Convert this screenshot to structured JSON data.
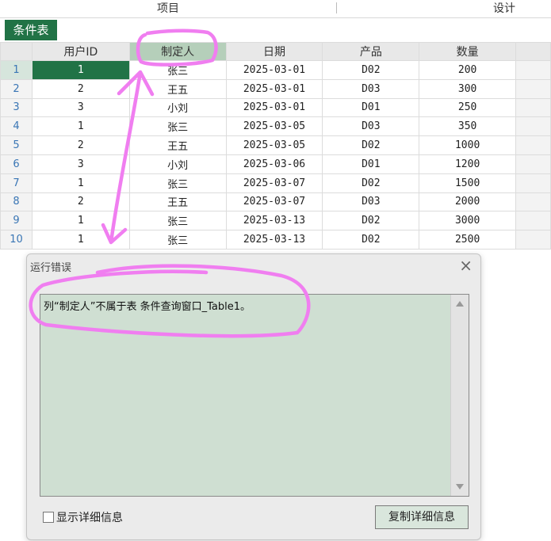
{
  "header": {
    "left_title": "项目",
    "right_title": "设计"
  },
  "tab": {
    "label": "条件表"
  },
  "table": {
    "columns": [
      "用户ID",
      "制定人",
      "日期",
      "产品",
      "数量"
    ],
    "rows": [
      {
        "num": "1",
        "cells": [
          "1",
          "张三",
          "2025-03-01",
          "D02",
          "200"
        ]
      },
      {
        "num": "2",
        "cells": [
          "2",
          "王五",
          "2025-03-01",
          "D03",
          "300"
        ]
      },
      {
        "num": "3",
        "cells": [
          "3",
          "小刘",
          "2025-03-01",
          "D01",
          "250"
        ]
      },
      {
        "num": "4",
        "cells": [
          "1",
          "张三",
          "2025-03-05",
          "D03",
          "350"
        ]
      },
      {
        "num": "5",
        "cells": [
          "2",
          "王五",
          "2025-03-05",
          "D02",
          "1000"
        ]
      },
      {
        "num": "6",
        "cells": [
          "3",
          "小刘",
          "2025-03-06",
          "D01",
          "1200"
        ]
      },
      {
        "num": "7",
        "cells": [
          "1",
          "张三",
          "2025-03-07",
          "D02",
          "1500"
        ]
      },
      {
        "num": "8",
        "cells": [
          "2",
          "王五",
          "2025-03-07",
          "D03",
          "2000"
        ]
      },
      {
        "num": "9",
        "cells": [
          "1",
          "张三",
          "2025-03-13",
          "D02",
          "3000"
        ]
      },
      {
        "num": "10",
        "cells": [
          "1",
          "张三",
          "2025-03-13",
          "D02",
          "2500"
        ]
      }
    ]
  },
  "dialog": {
    "title": "运行错误",
    "message": "列“制定人”不属于表 条件查询窗口_Table1。",
    "close_icon": "close-icon",
    "checkbox_label": "显示详细信息",
    "copy_button_label": "复制详细信息"
  },
  "colors": {
    "accent_green": "#217346",
    "message_bg": "#cfdfd2",
    "annotation_pink": "#f07ef0"
  }
}
